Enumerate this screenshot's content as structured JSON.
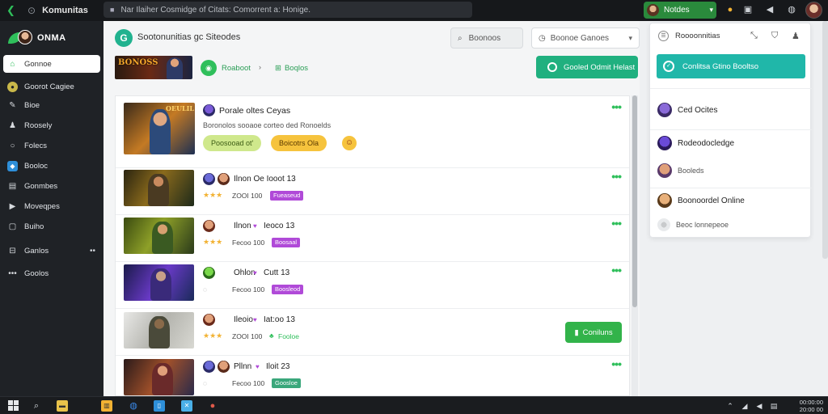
{
  "topbar": {
    "app_title": "Komunitas",
    "url": "Nar Ilaiher Cosmidge of Citats: Comorrent a: Honige.",
    "user_name": "Notdes",
    "icons": [
      "back-arrow-icon",
      "lock-icon",
      "coin-icon",
      "folder-icon",
      "sound-icon",
      "globe-icon"
    ]
  },
  "sidebar": {
    "brand": "ONMA",
    "items": [
      {
        "label": "Gonnoe",
        "icon": "home-icon"
      },
      {
        "label": "Goorot Cagiee",
        "icon": "badge-icon"
      },
      {
        "label": "Bioe",
        "icon": "pin-icon"
      },
      {
        "label": "Roosely",
        "icon": "user-icon"
      },
      {
        "label": "Folecs",
        "icon": "circle-icon"
      },
      {
        "label": "Booloc",
        "icon": "app-icon"
      },
      {
        "label": "Gonmbes",
        "icon": "document-icon"
      },
      {
        "label": "Moveqpes",
        "icon": "video-icon"
      },
      {
        "label": "Buiho",
        "icon": "bag-icon"
      },
      {
        "label": "Ganlos",
        "icon": "gamepad-icon"
      },
      {
        "label": "Goolos",
        "icon": "more-icon"
      }
    ]
  },
  "main": {
    "header_title": "Sootonunitias gc Siteodes",
    "search_label": "Boonoos",
    "filter_label": "Boonoe Ganoes",
    "banner_text": "BONOSS",
    "sub_a": "Roaboot",
    "sub_b": "Boqlos",
    "cta_label": "Gooled Odmit Helast"
  },
  "feed": {
    "featured": {
      "title": "Porale oltes Ceyas",
      "desc": "Boronolos sooaoe corteo ded Ronoelds",
      "pill_a": "Poosooad ot'",
      "pill_b": "Boicotrs Ola",
      "thumb_label": "OEULIL"
    },
    "items": [
      {
        "title": "Ilnon Oe Iooot 13",
        "meta": "ZOOI 100",
        "tag": "Fueaseud",
        "tag_color": "purple",
        "action": ""
      },
      {
        "title": "Ilnon",
        "title2": "Ieoco 13",
        "meta": "Fecoo 100",
        "tag": "Boosaal",
        "tag_color": "purple",
        "action": ""
      },
      {
        "title": "Ohlon",
        "title2": "Cutt 13",
        "meta": "Fecoo 100",
        "tag": "Boosleod",
        "tag_color": "purple",
        "action": ""
      },
      {
        "title": "Ileoio",
        "title2": "Iat:oo 13",
        "meta": "ZOOI 100",
        "tag": "Fooloe",
        "tag_color": "green",
        "action": "Coniluns"
      },
      {
        "title": "Pllnn",
        "title2": "Iloit 23",
        "meta": "Fecoo 100",
        "tag": "Goosloe",
        "tag_color": "teal",
        "action": ""
      }
    ]
  },
  "right_panel": {
    "title": "Roooonnitias",
    "button_label": "Conlitsa Gtino Booltso",
    "items": [
      {
        "label": "Ced Ocites",
        "kind": "big"
      },
      {
        "label": "Rodeodocledge",
        "kind": "big"
      },
      {
        "label": "Booleds",
        "kind": "small"
      },
      {
        "label": "Boonoordel Online",
        "kind": "big"
      },
      {
        "label": "Beoc lonnepeoe",
        "kind": "small"
      }
    ]
  },
  "taskbar": {
    "time": "00:00:00",
    "date": "20:00 00"
  }
}
